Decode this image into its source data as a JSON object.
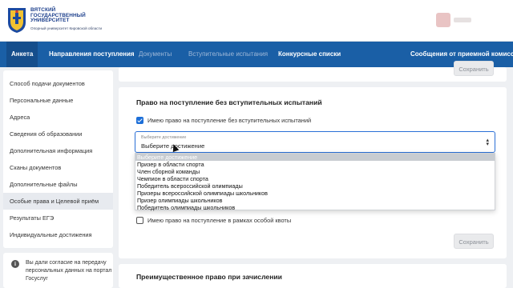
{
  "header": {
    "university": [
      "ВЯТСКИЙ",
      "ГОСУДАРСТВЕННЫЙ",
      "УНИВЕРСИТЕТ"
    ],
    "subtitle": "Опорный университет Кировской области"
  },
  "nav": {
    "items": [
      {
        "label": "Анкета",
        "state": "active"
      },
      {
        "label": "Направления поступления",
        "state": "enabled"
      },
      {
        "label": "Документы",
        "state": "disabled"
      },
      {
        "label": "Вступительные испытания",
        "state": "disabled"
      },
      {
        "label": "Конкурсные списки",
        "state": "enabled"
      },
      {
        "label": "Сообщения от приемной комиссии",
        "state": "enabled"
      }
    ]
  },
  "sidebar": {
    "items": [
      "Способ подачи документов",
      "Персональные данные",
      "Адреса",
      "Сведения об образовании",
      "Дополнительная информация",
      "Сканы документов",
      "Дополнительные файлы",
      "Особые права и Целевой приём",
      "Результаты ЕГЭ",
      "Индивидуальные достижения"
    ],
    "active_index": 7,
    "consent_text": "Вы дали согласие на передачу персональных данных на портал Госуслуг"
  },
  "main": {
    "save_label": "Сохранить",
    "no_exam_section": {
      "title": "Право на поступление без вступительных испытаний",
      "checkbox_label": "Имею право на поступление без вступительных испытаний",
      "checkbox_checked": true,
      "select_label": "Выберите достижение",
      "select_value": "Выберите достижение",
      "options": [
        "Выберите достижение",
        "Призер в области спорта",
        "Член сборной команды",
        "Чемпион в области спорта",
        "Победитель всероссийской олимпиады",
        "Призеры всероссийской олимпиады школьников",
        "Призер олимпиады школьников",
        "Победитель олимпиады школьников"
      ],
      "highlighted_option_index": 0
    },
    "quota_section": {
      "checkbox_label": "Имею право на поступление в рамках особой квоты",
      "checkbox_checked": false
    },
    "priority_section": {
      "title": "Преимущественное право при зачислении"
    }
  },
  "colors": {
    "nav_bg": "#1a5fa6",
    "accent": "#1d6fd8",
    "brand_text": "#1c3f8c"
  }
}
